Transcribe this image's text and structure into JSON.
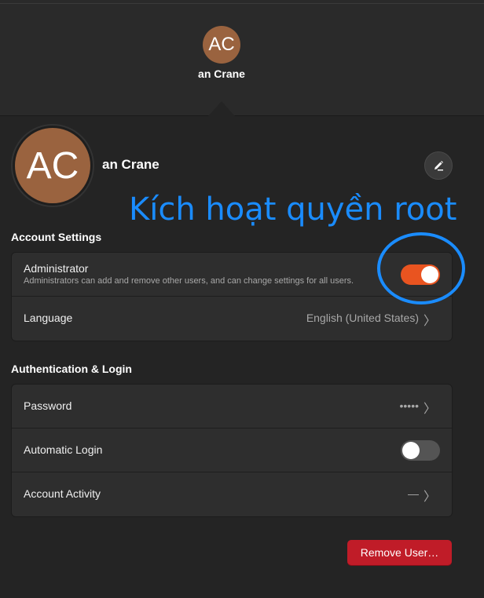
{
  "header": {
    "avatar_initials": "AC",
    "user_name": "an Crane"
  },
  "profile": {
    "avatar_initials": "AC",
    "user_name": "an Crane",
    "edit_icon": "pencil-icon"
  },
  "annotation": {
    "text": "Kích hoạt quyền root",
    "color": "#1a8cff"
  },
  "account_settings": {
    "title": "Account Settings",
    "administrator": {
      "label": "Administrator",
      "description": "Administrators can add and remove other users, and can change settings for all users.",
      "enabled": true
    },
    "language": {
      "label": "Language",
      "value": "English (United States)"
    }
  },
  "auth_login": {
    "title": "Authentication & Login",
    "password": {
      "label": "Password",
      "value": "•••••"
    },
    "automatic_login": {
      "label": "Automatic Login",
      "enabled": false
    },
    "account_activity": {
      "label": "Account Activity",
      "value": "—"
    }
  },
  "actions": {
    "remove_user_label": "Remove User…"
  },
  "colors": {
    "accent": "#e95420",
    "destructive": "#c01c28",
    "avatar": "#9a633f",
    "annotation": "#1a8cff"
  }
}
